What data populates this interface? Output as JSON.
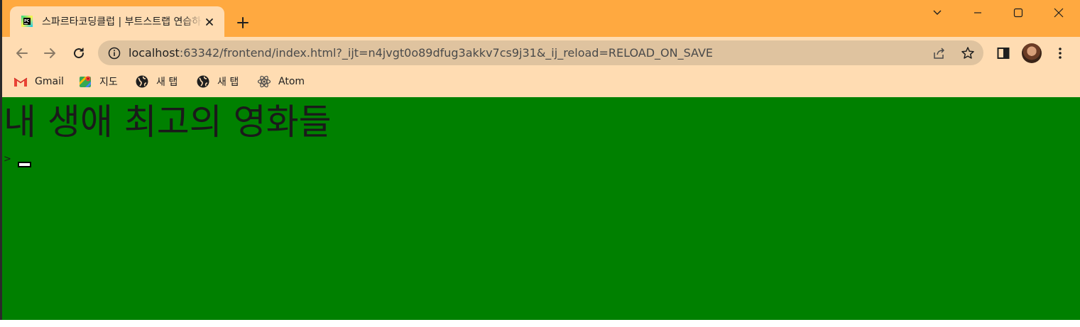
{
  "tab": {
    "title": "스파르타코딩클럽 | 부트스트랩 연습하기",
    "favicon": "pycharm-icon"
  },
  "toolbar": {
    "url_host": "localhost",
    "url_rest": ":63342/frontend/index.html?_ijt=n4jvgt0o89dfug3akkv7cs9j31&_ij_reload=RELOAD_ON_SAVE"
  },
  "bookmarks": [
    {
      "label": "Gmail",
      "icon": "gmail-icon"
    },
    {
      "label": "지도",
      "icon": "maps-icon"
    },
    {
      "label": "새 탭",
      "icon": "globe-icon"
    },
    {
      "label": "새 탭",
      "icon": "globe-icon"
    },
    {
      "label": "Atom",
      "icon": "atom-icon"
    }
  ],
  "page": {
    "heading": "내 생애 최고의 영화들",
    "prompt": ">"
  },
  "colors": {
    "titlebar": "#ffa940",
    "toolbar": "#ffdcb2",
    "omnibox": "#dfc39f",
    "page_bg": "#008000"
  }
}
